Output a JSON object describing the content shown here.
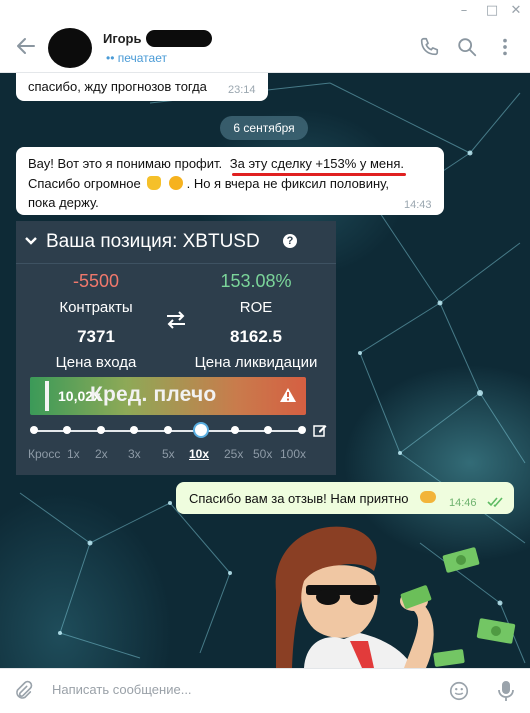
{
  "window": {
    "minimize": "–",
    "maximize": "□",
    "close": "✕"
  },
  "header": {
    "contact_name": "Игорь",
    "status": "•• печатает"
  },
  "messages": [
    {
      "text": "спасибо, жду прогнозов тогда",
      "time": "23:14"
    },
    {
      "date": "6 сентября"
    },
    {
      "text_line1_a": "Вау! Вот это я понимаю профит.",
      "text_line1_b": "За эту сделку +153% у меня.",
      "text_line2_a": "Спасибо огромное",
      "text_line2_b": ". Но я вчера не фиксил половину,",
      "text_line3": "пока держу.",
      "time": "14:43"
    },
    {
      "text": "Спасибо вам за отзыв! Нам приятно",
      "time": "14:46"
    }
  ],
  "position_card": {
    "title": "Ваша позиция: XBTUSD",
    "contracts_value": "-5500",
    "contracts_label": "Контракты",
    "roe_value": "153.08%",
    "roe_label": "ROE",
    "entry_value": "7371",
    "entry_label": "Цена входа",
    "liq_value": "8162.5",
    "liq_label": "Цена ликвидации",
    "leverage_value": "10,02x",
    "leverage_label": "Кред. плечо",
    "ticks": [
      "Кросс",
      "1x",
      "2x",
      "3x",
      "5x",
      "10x",
      "25x",
      "50x",
      "100x"
    ],
    "selected_tick": "10x",
    "colors": {
      "negative": "#f0786c",
      "positive": "#7bd59a"
    }
  },
  "input": {
    "placeholder": "Написать сообщение..."
  },
  "icons": [
    "back-arrow-icon",
    "phone-icon",
    "search-icon",
    "more-icon",
    "paperclip-icon",
    "emoji-icon",
    "microphone-icon",
    "question-icon",
    "swap-arrows-icon",
    "warning-icon",
    "edit-icon",
    "double-check-icon",
    "handshake-icon",
    "victory-hand-icon",
    "smile-icon"
  ]
}
